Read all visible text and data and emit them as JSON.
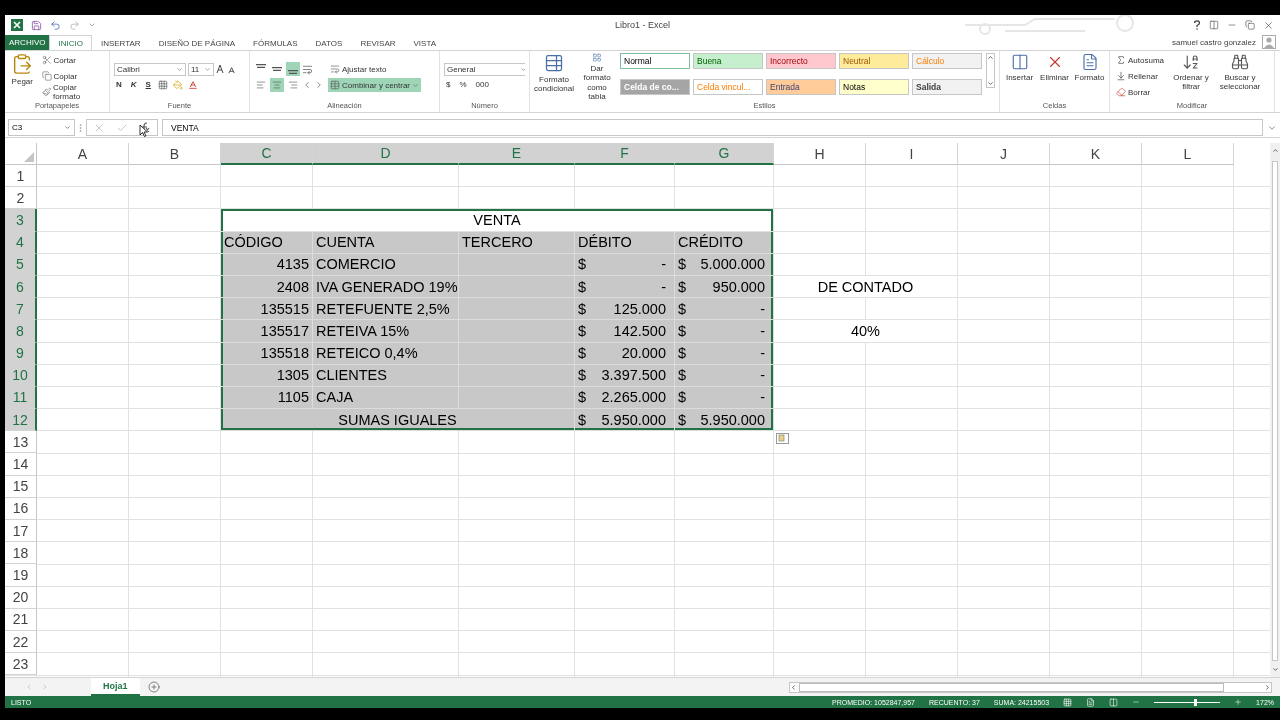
{
  "window": {
    "title": "Libro1 - Excel",
    "user": "samuel castro gonzalez"
  },
  "ribbon_tabs": [
    {
      "label": "ARCHIVO",
      "kind": "file",
      "selected": false
    },
    {
      "label": "INICIO",
      "kind": "tab",
      "selected": true
    },
    {
      "label": "INSERTAR",
      "kind": "tab",
      "selected": false
    },
    {
      "label": "DISEÑO DE PÁGINA",
      "kind": "tab",
      "selected": false
    },
    {
      "label": "FÓRMULAS",
      "kind": "tab",
      "selected": false
    },
    {
      "label": "DATOS",
      "kind": "tab",
      "selected": false
    },
    {
      "label": "REVISAR",
      "kind": "tab",
      "selected": false
    },
    {
      "label": "VISTA",
      "kind": "tab",
      "selected": false
    }
  ],
  "ribbon_groups": [
    {
      "kind": "clipboard",
      "label": "Portapapeles",
      "big": "Pegar",
      "items": [
        "Cortar",
        "Copiar",
        "Copiar formato"
      ]
    },
    {
      "kind": "font",
      "label": "Fuente",
      "font": "Calibri",
      "size": "11",
      "styles": [
        "N",
        "K",
        "S"
      ]
    },
    {
      "kind": "alignment",
      "label": "Alineación",
      "vertical": [
        {
          "selected": false
        },
        {
          "selected": false
        },
        {
          "selected": true
        }
      ],
      "horizontal": [
        {
          "selected": false
        },
        {
          "selected": true
        },
        {
          "selected": false
        }
      ],
      "wrap": "Ajustar texto",
      "merge": {
        "text": "Combinar y centrar",
        "selected": true
      }
    },
    {
      "kind": "number",
      "label": "Número",
      "format": "General",
      "symbols": [
        "$",
        "%",
        "000"
      ]
    },
    {
      "kind": "styles",
      "label": "Estilos",
      "buttons": [
        "Formato condicional",
        "Dar formato como tabla"
      ],
      "cells": [
        {
          "text": "Normal",
          "color": "#ffffff",
          "kind": "normal",
          "selected": true
        },
        {
          "text": "Buena",
          "color": "#c6efce",
          "kind": "good",
          "selected": false
        },
        {
          "text": "Incorrecto",
          "color": "#ffc7ce",
          "kind": "bad",
          "selected": false
        },
        {
          "text": "Neutral",
          "color": "#ffeb9c",
          "kind": "neutral",
          "selected": false
        },
        {
          "text": "Cálculo",
          "color": "#f2f2f2",
          "kind": "calculation",
          "selected": false
        },
        {
          "text": "Celda de co...",
          "color": "#a5a5a5",
          "kind": "check",
          "selected": false
        },
        {
          "text": "Celda vincul...",
          "color": "#ffffff",
          "kind": "linked",
          "selected": false
        },
        {
          "text": "Entrada",
          "color": "#ffcc99",
          "kind": "input",
          "selected": false
        },
        {
          "text": "Notas",
          "color": "#ffffcc",
          "kind": "note",
          "selected": false
        },
        {
          "text": "Salida",
          "color": "#f2f2f2",
          "kind": "output",
          "selected": false
        }
      ]
    },
    {
      "kind": "cells",
      "label": "Celdas",
      "items": [
        "Insertar",
        "Eliminar",
        "Formato"
      ]
    },
    {
      "kind": "editing",
      "label": "Modificar",
      "items": [
        "Autosuma",
        "Rellenar",
        "Borrar"
      ],
      "big": [
        "Ordenar y filtrar",
        "Buscar y seleccionar"
      ]
    }
  ],
  "formula_bar": {
    "name_box": "C3",
    "content": "VENTA"
  },
  "columns": [
    {
      "label": "A",
      "selected": false
    },
    {
      "label": "B",
      "selected": false
    },
    {
      "label": "C",
      "selected": true
    },
    {
      "label": "D",
      "selected": true
    },
    {
      "label": "E",
      "selected": true
    },
    {
      "label": "F",
      "selected": true
    },
    {
      "label": "G",
      "selected": true
    },
    {
      "label": "H",
      "selected": false
    },
    {
      "label": "I",
      "selected": false
    },
    {
      "label": "J",
      "selected": false
    },
    {
      "label": "K",
      "selected": false
    },
    {
      "label": "L",
      "selected": false
    }
  ],
  "rows": [
    {
      "number": "1",
      "selected": false
    },
    {
      "number": "2",
      "selected": false
    },
    {
      "number": "3",
      "selected": true,
      "cells": [
        null,
        null,
        {
          "kind": "title",
          "text": "VENTA",
          "active": true
        },
        {
          "kind": "covered"
        },
        {
          "kind": "covered"
        },
        {
          "kind": "covered"
        },
        {
          "kind": "covered"
        }
      ]
    },
    {
      "number": "4",
      "selected": true,
      "cells": [
        null,
        null,
        {
          "kind": "label",
          "text": "CÓDIGO",
          "active": false
        },
        {
          "kind": "label",
          "text": "CUENTA",
          "active": false
        },
        {
          "kind": "label",
          "text": "TERCERO",
          "active": false
        },
        {
          "kind": "label",
          "text": "DÉBITO",
          "active": false
        },
        {
          "kind": "label",
          "text": "CRÉDITO",
          "active": false
        }
      ]
    },
    {
      "number": "5",
      "selected": true,
      "cells": [
        null,
        null,
        {
          "kind": "number",
          "text": "4135",
          "active": false
        },
        {
          "kind": "label",
          "text": "COMERCIO",
          "active": false
        },
        null,
        {
          "kind": "money",
          "symbol": "$",
          "amount": "-",
          "active": false
        },
        {
          "kind": "money",
          "symbol": "$",
          "amount": "5.000.000",
          "active": false
        }
      ]
    },
    {
      "number": "6",
      "selected": true,
      "cells": [
        null,
        null,
        {
          "kind": "number",
          "text": "2408",
          "active": false
        },
        {
          "kind": "label",
          "text": "IVA GENERADO 19%",
          "active": false
        },
        null,
        {
          "kind": "money",
          "symbol": "$",
          "amount": "-",
          "active": false
        },
        {
          "kind": "money",
          "symbol": "$",
          "amount": "950.000",
          "active": false
        },
        {
          "kind": "title",
          "text": "DE CONTADO"
        },
        {
          "kind": "covered"
        }
      ]
    },
    {
      "number": "7",
      "selected": true,
      "cells": [
        null,
        null,
        {
          "kind": "number",
          "text": "135515",
          "active": false
        },
        {
          "kind": "label",
          "text": "RETEFUENTE 2,5%",
          "active": false
        },
        null,
        {
          "kind": "money",
          "symbol": "$",
          "amount": "125.000",
          "active": false
        },
        {
          "kind": "money",
          "symbol": "$",
          "amount": "-",
          "active": false
        }
      ]
    },
    {
      "number": "8",
      "selected": true,
      "cells": [
        null,
        null,
        {
          "kind": "number",
          "text": "135517",
          "active": false
        },
        {
          "kind": "label",
          "text": "RETEIVA 15%",
          "active": false
        },
        null,
        {
          "kind": "money",
          "symbol": "$",
          "amount": "142.500",
          "active": false
        },
        {
          "kind": "money",
          "symbol": "$",
          "amount": "-",
          "active": false
        },
        {
          "kind": "title",
          "text": "40%"
        },
        {
          "kind": "covered"
        }
      ]
    },
    {
      "number": "9",
      "selected": true,
      "cells": [
        null,
        null,
        {
          "kind": "number",
          "text": "135518",
          "active": false
        },
        {
          "kind": "label",
          "text": "RETEICO 0,4%",
          "active": false
        },
        null,
        {
          "kind": "money",
          "symbol": "$",
          "amount": "20.000",
          "active": false
        },
        {
          "kind": "money",
          "symbol": "$",
          "amount": "-",
          "active": false
        }
      ]
    },
    {
      "number": "10",
      "selected": true,
      "cells": [
        null,
        null,
        {
          "kind": "number",
          "text": "1305",
          "active": false
        },
        {
          "kind": "label",
          "text": "CLIENTES",
          "active": false
        },
        null,
        {
          "kind": "money",
          "symbol": "$",
          "amount": "3.397.500",
          "active": false
        },
        {
          "kind": "money",
          "symbol": "$",
          "amount": "-",
          "active": false
        }
      ]
    },
    {
      "number": "11",
      "selected": true,
      "cells": [
        null,
        null,
        {
          "kind": "number",
          "text": "1105",
          "active": false
        },
        {
          "kind": "label",
          "text": "CAJA",
          "active": false
        },
        null,
        {
          "kind": "money",
          "symbol": "$",
          "amount": "2.265.000",
          "active": false
        },
        {
          "kind": "money",
          "symbol": "$",
          "amount": "-",
          "active": false
        }
      ]
    },
    {
      "number": "12",
      "selected": true,
      "cells": [
        null,
        null,
        {
          "kind": "title",
          "text": "SUMAS IGUALES",
          "active": false
        },
        {
          "kind": "covered"
        },
        {
          "kind": "covered"
        },
        {
          "kind": "money",
          "symbol": "$",
          "amount": "5.950.000",
          "active": false
        },
        {
          "kind": "money",
          "symbol": "$",
          "amount": "5.950.000",
          "active": false
        }
      ]
    },
    {
      "number": "13",
      "selected": false
    },
    {
      "number": "14",
      "selected": false
    },
    {
      "number": "15",
      "selected": false
    },
    {
      "number": "16",
      "selected": false
    },
    {
      "number": "17",
      "selected": false
    },
    {
      "number": "18",
      "selected": false
    },
    {
      "number": "19",
      "selected": false
    },
    {
      "number": "20",
      "selected": false
    },
    {
      "number": "21",
      "selected": false
    },
    {
      "number": "22",
      "selected": false
    },
    {
      "number": "23",
      "selected": false
    }
  ],
  "sheets": [
    {
      "label": "Hoja1",
      "selected": true
    }
  ],
  "status_bar": {
    "mode": "LISTO",
    "stats": [
      "PROMEDIO: 1052847,957",
      "RECUENTO: 37",
      "SUMA: 24215503"
    ],
    "zoom": "172%",
    "level": 0.6
  }
}
